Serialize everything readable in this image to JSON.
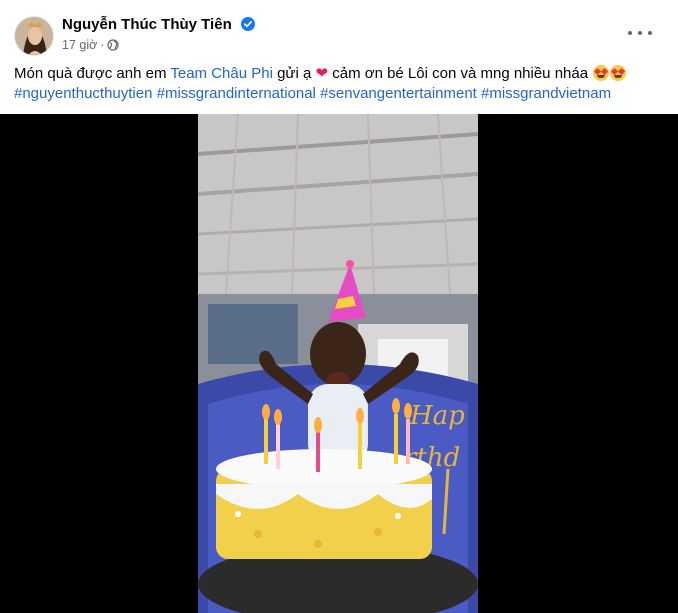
{
  "post": {
    "author": "Nguyễn Thúc Thùy Tiên",
    "time": "17 giờ",
    "separator": "·",
    "text": {
      "part1": "Món quà được anh em ",
      "mention": "Team Châu Phi",
      "part2": " gửi ạ ",
      "heart": "❤",
      "part3": " cảm ơn bé Lôi con và mng nhiều nháa "
    },
    "hashtags": [
      "#nguyenthucthuytien",
      "#missgrandinternational",
      "#senvangentertainment",
      "#missgrandvietnam"
    ]
  },
  "video": {
    "cake_topper": "Happy Birthday"
  },
  "icons": {
    "verified": "verified-badge-icon",
    "audience": "globe-icon",
    "menu": "more-options-icon"
  },
  "colors": {
    "link": "#2366c9",
    "verified": "#1877f2",
    "meta": "#65676b"
  }
}
